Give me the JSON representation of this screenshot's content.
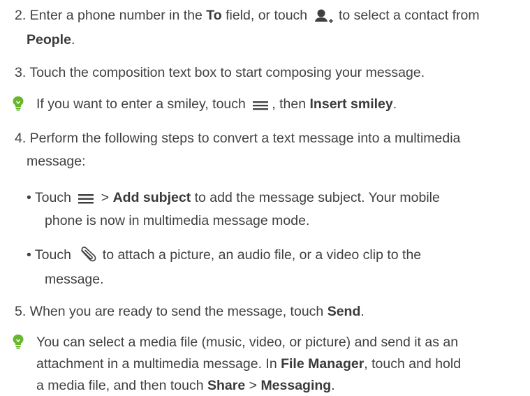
{
  "steps": {
    "s2": {
      "a": "2. Enter a phone number in the ",
      "b_to": "To",
      "c": " field, or touch ",
      "d": " to select a contact from",
      "people": "People",
      "period": "."
    },
    "s3": {
      "text": "3. Touch the composition text box to start composing your message."
    },
    "tip1": {
      "a": "If you want to enter a smiley, touch ",
      "b": ", then ",
      "insert_smiley": "Insert smiley",
      "period": "."
    },
    "s4": {
      "line1": "4. Perform the following steps to convert a text message into a multimedia",
      "line2": "message:"
    },
    "b1": {
      "a": "• Touch ",
      "gt": " > ",
      "add_subject": "Add subject",
      "b": " to add the message subject. Your mobile",
      "line2": "phone is now in multimedia message mode."
    },
    "b2": {
      "a": "• Touch ",
      "b": " to attach a picture, an audio file, or a video clip to the",
      "line2": "message."
    },
    "s5": {
      "a": "5. When you are ready to send the message, touch ",
      "send": "Send",
      "period": "."
    },
    "tip2": {
      "line1": "You can select a media file (music, video, or picture) and send it as an",
      "line2a": "attachment in a multimedia message. In ",
      "file_manager": "File Manager",
      "line2b": ", touch and hold",
      "line3a": "a media file, and then touch ",
      "share": "Share",
      "gt": " > ",
      "messaging": "Messaging",
      "period": "."
    }
  },
  "icons": {
    "contact": "person-add-icon",
    "menu": "menu-icon",
    "attach": "paperclip-icon",
    "tip": "lightbulb-icon"
  },
  "colors": {
    "text": "#404040",
    "tip_green": "#6ab52e"
  }
}
